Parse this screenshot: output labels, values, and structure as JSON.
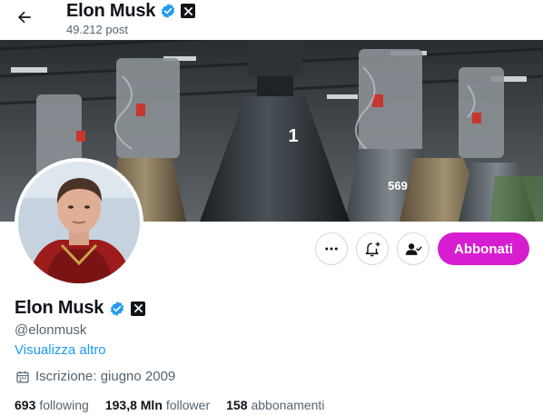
{
  "header": {
    "name": "Elon Musk",
    "posts": "49.212 post"
  },
  "banner": {
    "engine_numbers": [
      "1",
      "569"
    ]
  },
  "actions": {
    "subscribe_label": "Abbonati",
    "more_icon": "more-horizontal-icon",
    "notify_icon": "bell-plus-icon",
    "follow_icon": "user-check-icon"
  },
  "profile": {
    "name": "Elon Musk",
    "handle": "@elonmusk",
    "see_more": "Visualizza altro",
    "joined": "Iscrizione: giugno 2009"
  },
  "stats": [
    {
      "value": "693",
      "label": "following"
    },
    {
      "value": "193,8 Mln",
      "label": "follower"
    },
    {
      "value": "158",
      "label": "abbonamenti"
    }
  ],
  "colors": {
    "verified": "#1d9bf0",
    "subscribe": "#d61ed0",
    "link": "#1d9bf0",
    "muted": "#536471"
  }
}
